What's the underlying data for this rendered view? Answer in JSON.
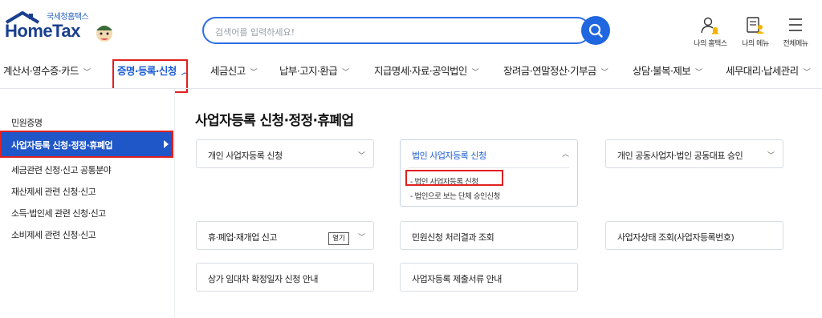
{
  "header": {
    "logo_sub": "국세청홈택스",
    "logo_main": "HomeTax",
    "search_placeholder": "검색어를 입력하세요!",
    "util": [
      {
        "label": "나의 홈택스",
        "icon": "user-bell-icon"
      },
      {
        "label": "나의 메뉴",
        "icon": "my-menu-icon"
      },
      {
        "label": "전체메뉴",
        "icon": "hamburger-icon"
      }
    ]
  },
  "gnb": [
    {
      "label": "계산서·영수증·카드",
      "chevron": "down"
    },
    {
      "label": "증명·등록·신청",
      "chevron": "up",
      "active": true
    },
    {
      "label": "세금신고",
      "chevron": "down"
    },
    {
      "label": "납부·고지·환급",
      "chevron": "down"
    },
    {
      "label": "지급명세·자료·공익법인",
      "chevron": "down"
    },
    {
      "label": "장려금·연말정산·기부금",
      "chevron": "down"
    },
    {
      "label": "상담·불복·제보",
      "chevron": "down"
    },
    {
      "label": "세무대리·납세관리",
      "chevron": "down"
    }
  ],
  "sidebar": {
    "items": [
      {
        "label": "민원증명"
      },
      {
        "label": "사업자등록 신청·정정·휴폐업",
        "active": true
      },
      {
        "label": "세금관련 신청·신고 공통분야"
      },
      {
        "label": "재산제세 관련 신청·신고"
      },
      {
        "label": "소득·법인세 관련 신청·신고"
      },
      {
        "label": "소비제세 관련 신청·신고"
      }
    ]
  },
  "main": {
    "title": "사업자등록 신청·정정·휴폐업",
    "cards": [
      {
        "label": "개인 사업자등록 신청",
        "chevron": "down"
      },
      {
        "label": "법인 사업자등록 신청",
        "chevron": "up",
        "open": true,
        "sub_items": [
          "- 법인 사업자등록 신청",
          "- 법인으로 보는 단체 승인신청"
        ]
      },
      {
        "label": "개인 공동사업자·법인 공동대표 승인",
        "chevron": "down"
      },
      {
        "label": "휴·폐업·재개업 신고",
        "chevron": "down",
        "badge": "열기"
      },
      {
        "label": "민원신청 처리결과 조회"
      },
      {
        "label": "사업자상태 조회(사업자등록번호)"
      },
      {
        "label": "상가 임대차 확정일자 신청 안내"
      },
      {
        "label": "사업자등록 제출서류 안내"
      }
    ]
  },
  "colors": {
    "brand_blue": "#1f56c8",
    "accent_blue": "#1f66e0",
    "highlight_red": "#e02020"
  }
}
